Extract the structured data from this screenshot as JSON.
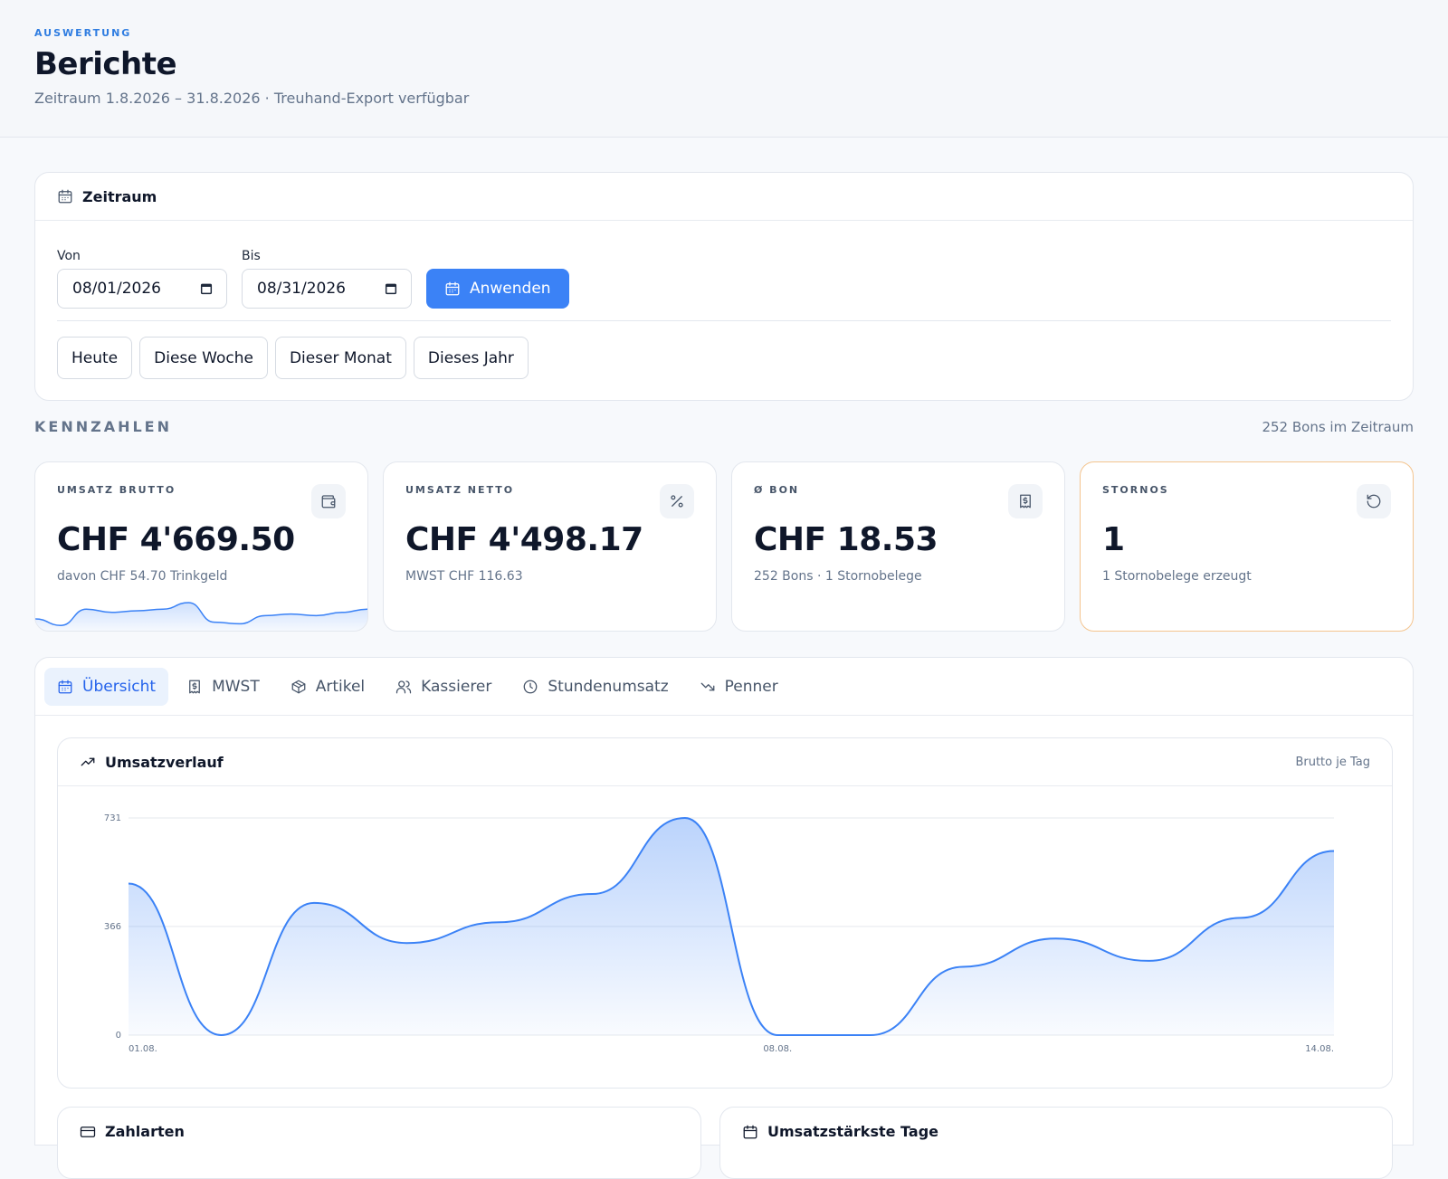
{
  "header": {
    "eyebrow": "AUSWERTUNG",
    "title": "Berichte",
    "subtitle": "Zeitraum 1.8.2026 – 31.8.2026 · Treuhand-Export verfügbar"
  },
  "zeitraum": {
    "title": "Zeitraum",
    "from_label": "Von",
    "from_value": "08/01/2026",
    "to_label": "Bis",
    "to_value": "08/31/2026",
    "apply_label": "Anwenden",
    "presets": [
      "Heute",
      "Diese Woche",
      "Dieser Monat",
      "Dieses Jahr"
    ]
  },
  "kpi": {
    "section_label": "KENNZAHLEN",
    "count_text": "252 Bons im Zeitraum",
    "cards": [
      {
        "title": "UMSATZ BRUTTO",
        "value": "CHF 4'669.50",
        "sub": "davon CHF 54.70 Trinkgeld",
        "icon": "wallet-icon"
      },
      {
        "title": "UMSATZ NETTO",
        "value": "CHF 4'498.17",
        "sub": "MWST CHF 116.63",
        "icon": "percent-icon"
      },
      {
        "title": "Ø BON",
        "value": "CHF 18.53",
        "sub": "252 Bons · 1 Stornobelege",
        "icon": "receipt-icon"
      },
      {
        "title": "STORNOS",
        "value": "1",
        "sub": "1 Stornobelege erzeugt",
        "icon": "undo-icon"
      }
    ],
    "accent_color": "#3b82f6",
    "warning_border": "#f4c48e"
  },
  "tabs": [
    {
      "label": "Übersicht",
      "icon": "calendar-icon",
      "active": true
    },
    {
      "label": "MWST",
      "icon": "receipt-icon",
      "active": false
    },
    {
      "label": "Artikel",
      "icon": "box-icon",
      "active": false
    },
    {
      "label": "Kassierer",
      "icon": "users-icon",
      "active": false
    },
    {
      "label": "Stundenumsatz",
      "icon": "clock-icon",
      "active": false
    },
    {
      "label": "Penner",
      "icon": "trending-down-icon",
      "active": false
    }
  ],
  "chart": {
    "title": "Umsatzverlauf",
    "note": "Brutto je Tag"
  },
  "chart_data": {
    "type": "area",
    "title": "Umsatzverlauf",
    "x": [
      "01.08.",
      "02.08.",
      "03.08.",
      "04.08.",
      "05.08.",
      "06.08.",
      "07.08.",
      "08.08.",
      "09.08.",
      "10.08.",
      "11.08.",
      "12.08.",
      "13.08.",
      "14.08."
    ],
    "x_tick_labels": [
      "01.08.",
      "08.08.",
      "14.08."
    ],
    "values": [
      510,
      0,
      445,
      310,
      380,
      475,
      731,
      0,
      0,
      230,
      325,
      250,
      395,
      620
    ],
    "y_ticks": [
      "0",
      "366",
      "731"
    ],
    "ylim": [
      0,
      731
    ],
    "grid": true,
    "color": "#3b82f6",
    "sparkline_values": [
      0.25,
      0.05,
      0.55,
      0.45,
      0.5,
      0.55,
      0.75,
      0.15,
      0.1,
      0.35,
      0.4,
      0.35,
      0.45,
      0.55
    ]
  },
  "bottom_cards": [
    {
      "title": "Zahlarten",
      "icon": "credit-card-icon"
    },
    {
      "title": "Umsatzstärkste Tage",
      "icon": "calendar-icon"
    }
  ]
}
